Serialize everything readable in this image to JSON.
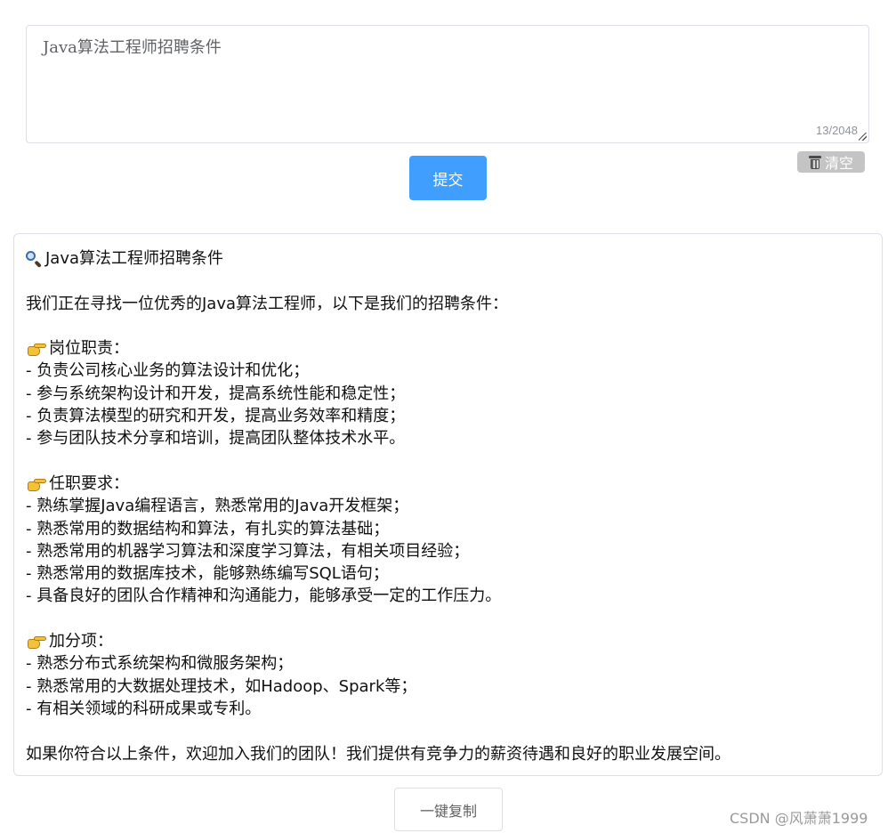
{
  "prompt": {
    "value": "Java算法工程师招聘条件",
    "char_count": "13/2048"
  },
  "clear_button": {
    "icon": "trash-icon",
    "label": "清空"
  },
  "submit_button": {
    "label": "提交"
  },
  "result": {
    "title": "Java算法工程师招聘条件",
    "intro": "我们正在寻找一位优秀的Java算法工程师，以下是我们的招聘条件：",
    "sections": [
      {
        "heading": "岗位职责：",
        "items": [
          "- 负责公司核心业务的算法设计和优化；",
          "- 参与系统架构设计和开发，提高系统性能和稳定性；",
          "- 负责算法模型的研究和开发，提高业务效率和精度；",
          "- 参与团队技术分享和培训，提高团队整体技术水平。"
        ]
      },
      {
        "heading": "任职要求：",
        "items": [
          "- 熟练掌握Java编程语言，熟悉常用的Java开发框架；",
          "- 熟悉常用的数据结构和算法，有扎实的算法基础；",
          "- 熟悉常用的机器学习算法和深度学习算法，有相关项目经验；",
          "- 熟悉常用的数据库技术，能够熟练编写SQL语句；",
          "- 具备良好的团队合作精神和沟通能力，能够承受一定的工作压力。"
        ]
      },
      {
        "heading": "加分项：",
        "items": [
          "- 熟悉分布式系统架构和微服务架构；",
          "- 熟悉常用的大数据处理技术，如Hadoop、Spark等；",
          "- 有相关领域的科研成果或专利。"
        ]
      }
    ],
    "closing": "如果你符合以上条件，欢迎加入我们的团队！我们提供有竞争力的薪资待遇和良好的职业发展空间。"
  },
  "copy_button": {
    "label": "一键复制"
  },
  "watermark": "CSDN @风萧萧1999",
  "colors": {
    "primary": "#409eff",
    "clear_bg": "#c4c4c4",
    "border": "#dcdfe6"
  }
}
